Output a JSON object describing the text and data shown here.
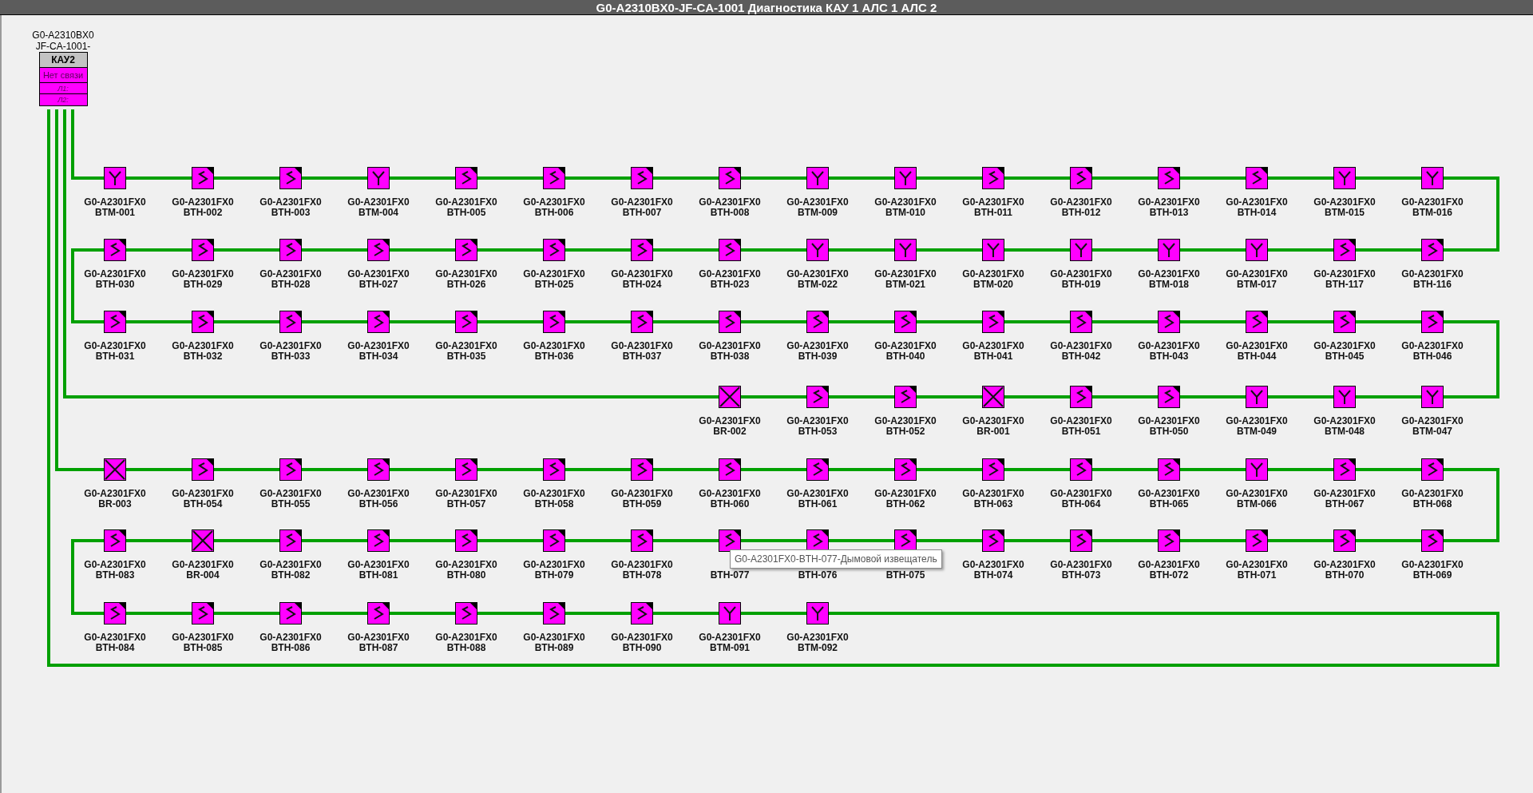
{
  "window": {
    "title": "G0-A2310BX0-JF-CA-1001 Диагностика КАУ 1 АЛС 1 АЛС 2"
  },
  "controller": {
    "caption_1": "G0-A2310BX0",
    "caption_2": "JF-CA-1001-",
    "name": "КАУ2",
    "status": "Нет связи",
    "line_1": "Л1:",
    "line_2": "Л2:"
  },
  "rows": [
    {
      "devices": [
        {
          "code": "G0-A2301FX0",
          "tag": "BTM-001",
          "kind": "heat"
        },
        {
          "code": "G0-A2301FX0",
          "tag": "BTH-002",
          "kind": "smoke"
        },
        {
          "code": "G0-A2301FX0",
          "tag": "BTH-003",
          "kind": "smoke"
        },
        {
          "code": "G0-A2301FX0",
          "tag": "BTM-004",
          "kind": "heat"
        },
        {
          "code": "G0-A2301FX0",
          "tag": "BTH-005",
          "kind": "smoke"
        },
        {
          "code": "G0-A2301FX0",
          "tag": "BTH-006",
          "kind": "smoke"
        },
        {
          "code": "G0-A2301FX0",
          "tag": "BTH-007",
          "kind": "smoke"
        },
        {
          "code": "G0-A2301FX0",
          "tag": "BTH-008",
          "kind": "smoke"
        },
        {
          "code": "G0-A2301FX0",
          "tag": "BTM-009",
          "kind": "heat"
        },
        {
          "code": "G0-A2301FX0",
          "tag": "BTM-010",
          "kind": "heat"
        },
        {
          "code": "G0-A2301FX0",
          "tag": "BTH-011",
          "kind": "smoke"
        },
        {
          "code": "G0-A2301FX0",
          "tag": "BTH-012",
          "kind": "smoke"
        },
        {
          "code": "G0-A2301FX0",
          "tag": "BTH-013",
          "kind": "smoke"
        },
        {
          "code": "G0-A2301FX0",
          "tag": "BTH-014",
          "kind": "smoke"
        },
        {
          "code": "G0-A2301FX0",
          "tag": "BTM-015",
          "kind": "heat"
        },
        {
          "code": "G0-A2301FX0",
          "tag": "BTM-016",
          "kind": "heat"
        }
      ]
    },
    {
      "devices": [
        {
          "code": "G0-A2301FX0",
          "tag": "BTH-030",
          "kind": "smoke"
        },
        {
          "code": "G0-A2301FX0",
          "tag": "BTH-029",
          "kind": "smoke"
        },
        {
          "code": "G0-A2301FX0",
          "tag": "BTH-028",
          "kind": "smoke"
        },
        {
          "code": "G0-A2301FX0",
          "tag": "BTH-027",
          "kind": "smoke"
        },
        {
          "code": "G0-A2301FX0",
          "tag": "BTH-026",
          "kind": "smoke"
        },
        {
          "code": "G0-A2301FX0",
          "tag": "BTH-025",
          "kind": "smoke"
        },
        {
          "code": "G0-A2301FX0",
          "tag": "BTH-024",
          "kind": "smoke"
        },
        {
          "code": "G0-A2301FX0",
          "tag": "BTH-023",
          "kind": "smoke"
        },
        {
          "code": "G0-A2301FX0",
          "tag": "BTM-022",
          "kind": "heat"
        },
        {
          "code": "G0-A2301FX0",
          "tag": "BTM-021",
          "kind": "heat"
        },
        {
          "code": "G0-A2301FX0",
          "tag": "BTM-020",
          "kind": "heat"
        },
        {
          "code": "G0-A2301FX0",
          "tag": "BTH-019",
          "kind": "heat"
        },
        {
          "code": "G0-A2301FX0",
          "tag": "BTM-018",
          "kind": "heat"
        },
        {
          "code": "G0-A2301FX0",
          "tag": "BTM-017",
          "kind": "heat"
        },
        {
          "code": "G0-A2301FX0",
          "tag": "BTH-117",
          "kind": "smoke"
        },
        {
          "code": "G0-A2301FX0",
          "tag": "BTH-116",
          "kind": "smoke"
        }
      ]
    },
    {
      "devices": [
        {
          "code": "G0-A2301FX0",
          "tag": "BTH-031",
          "kind": "smoke"
        },
        {
          "code": "G0-A2301FX0",
          "tag": "BTH-032",
          "kind": "smoke"
        },
        {
          "code": "G0-A2301FX0",
          "tag": "BTH-033",
          "kind": "smoke"
        },
        {
          "code": "G0-A2301FX0",
          "tag": "BTH-034",
          "kind": "smoke"
        },
        {
          "code": "G0-A2301FX0",
          "tag": "BTH-035",
          "kind": "smoke"
        },
        {
          "code": "G0-A2301FX0",
          "tag": "BTH-036",
          "kind": "smoke"
        },
        {
          "code": "G0-A2301FX0",
          "tag": "BTH-037",
          "kind": "smoke"
        },
        {
          "code": "G0-A2301FX0",
          "tag": "BTH-038",
          "kind": "smoke"
        },
        {
          "code": "G0-A2301FX0",
          "tag": "BTH-039",
          "kind": "smoke"
        },
        {
          "code": "G0-A2301FX0",
          "tag": "BTH-040",
          "kind": "smoke"
        },
        {
          "code": "G0-A2301FX0",
          "tag": "BTH-041",
          "kind": "smoke"
        },
        {
          "code": "G0-A2301FX0",
          "tag": "BTH-042",
          "kind": "smoke"
        },
        {
          "code": "G0-A2301FX0",
          "tag": "BTH-043",
          "kind": "smoke"
        },
        {
          "code": "G0-A2301FX0",
          "tag": "BTH-044",
          "kind": "smoke"
        },
        {
          "code": "G0-A2301FX0",
          "tag": "BTH-045",
          "kind": "smoke"
        },
        {
          "code": "G0-A2301FX0",
          "tag": "BTH-046",
          "kind": "smoke"
        }
      ]
    },
    {
      "devices": [
        {
          "code": "G0-A2301FX0",
          "tag": "BR-002",
          "kind": "manual"
        },
        {
          "code": "G0-A2301FX0",
          "tag": "BTH-053",
          "kind": "smoke"
        },
        {
          "code": "G0-A2301FX0",
          "tag": "BTH-052",
          "kind": "smoke"
        },
        {
          "code": "G0-A2301FX0",
          "tag": "BR-001",
          "kind": "manual"
        },
        {
          "code": "G0-A2301FX0",
          "tag": "BTH-051",
          "kind": "smoke"
        },
        {
          "code": "G0-A2301FX0",
          "tag": "BTH-050",
          "kind": "smoke"
        },
        {
          "code": "G0-A2301FX0",
          "tag": "BTM-049",
          "kind": "heat"
        },
        {
          "code": "G0-A2301FX0",
          "tag": "BTM-048",
          "kind": "heat"
        },
        {
          "code": "G0-A2301FX0",
          "tag": "BTM-047",
          "kind": "heat"
        }
      ]
    },
    {
      "devices": [
        {
          "code": "G0-A2301FX0",
          "tag": "BR-003",
          "kind": "manual"
        },
        {
          "code": "G0-A2301FX0",
          "tag": "BTH-054",
          "kind": "smoke"
        },
        {
          "code": "G0-A2301FX0",
          "tag": "BTH-055",
          "kind": "smoke"
        },
        {
          "code": "G0-A2301FX0",
          "tag": "BTH-056",
          "kind": "smoke"
        },
        {
          "code": "G0-A2301FX0",
          "tag": "BTH-057",
          "kind": "smoke"
        },
        {
          "code": "G0-A2301FX0",
          "tag": "BTH-058",
          "kind": "smoke"
        },
        {
          "code": "G0-A2301FX0",
          "tag": "BTH-059",
          "kind": "smoke"
        },
        {
          "code": "G0-A2301FX0",
          "tag": "BTH-060",
          "kind": "smoke"
        },
        {
          "code": "G0-A2301FX0",
          "tag": "BTH-061",
          "kind": "smoke"
        },
        {
          "code": "G0-A2301FX0",
          "tag": "BTH-062",
          "kind": "smoke"
        },
        {
          "code": "G0-A2301FX0",
          "tag": "BTH-063",
          "kind": "smoke"
        },
        {
          "code": "G0-A2301FX0",
          "tag": "BTH-064",
          "kind": "smoke"
        },
        {
          "code": "G0-A2301FX0",
          "tag": "BTH-065",
          "kind": "smoke"
        },
        {
          "code": "G0-A2301FX0",
          "tag": "BTM-066",
          "kind": "heat"
        },
        {
          "code": "G0-A2301FX0",
          "tag": "BTH-067",
          "kind": "smoke"
        },
        {
          "code": "G0-A2301FX0",
          "tag": "BTH-068",
          "kind": "smoke"
        }
      ]
    },
    {
      "devices": [
        {
          "code": "G0-A2301FX0",
          "tag": "BTH-083",
          "kind": "smoke"
        },
        {
          "code": "G0-A2301FX0",
          "tag": "BR-004",
          "kind": "manual"
        },
        {
          "code": "G0-A2301FX0",
          "tag": "BTH-082",
          "kind": "smoke"
        },
        {
          "code": "G0-A2301FX0",
          "tag": "BTH-081",
          "kind": "smoke"
        },
        {
          "code": "G0-A2301FX0",
          "tag": "BTH-080",
          "kind": "smoke"
        },
        {
          "code": "G0-A2301FX0",
          "tag": "BTH-079",
          "kind": "smoke"
        },
        {
          "code": "G0-A2301FX0",
          "tag": "BTH-078",
          "kind": "smoke"
        },
        {
          "tag": "BTH-077",
          "kind": "smoke"
        },
        {
          "tag": "BTH-076",
          "kind": "smoke"
        },
        {
          "tag": "BTH-075",
          "kind": "smoke"
        },
        {
          "code": "G0-A2301FX0",
          "tag": "BTH-074",
          "kind": "smoke"
        },
        {
          "code": "G0-A2301FX0",
          "tag": "BTH-073",
          "kind": "smoke"
        },
        {
          "code": "G0-A2301FX0",
          "tag": "BTH-072",
          "kind": "smoke"
        },
        {
          "code": "G0-A2301FX0",
          "tag": "BTH-071",
          "kind": "smoke"
        },
        {
          "code": "G0-A2301FX0",
          "tag": "BTH-070",
          "kind": "smoke"
        },
        {
          "code": "G0-A2301FX0",
          "tag": "BTH-069",
          "kind": "smoke"
        }
      ]
    },
    {
      "devices": [
        {
          "code": "G0-A2301FX0",
          "tag": "BTH-084",
          "kind": "smoke"
        },
        {
          "code": "G0-A2301FX0",
          "tag": "BTH-085",
          "kind": "smoke"
        },
        {
          "code": "G0-A2301FX0",
          "tag": "BTH-086",
          "kind": "smoke"
        },
        {
          "code": "G0-A2301FX0",
          "tag": "BTH-087",
          "kind": "smoke"
        },
        {
          "code": "G0-A2301FX0",
          "tag": "BTH-088",
          "kind": "smoke"
        },
        {
          "code": "G0-A2301FX0",
          "tag": "BTH-089",
          "kind": "smoke"
        },
        {
          "code": "G0-A2301FX0",
          "tag": "BTH-090",
          "kind": "smoke"
        },
        {
          "code": "G0-A2301FX0",
          "tag": "BTM-091",
          "kind": "heat"
        },
        {
          "code": "G0-A2301FX0",
          "tag": "BTM-092",
          "kind": "heat"
        }
      ]
    }
  ],
  "tooltip": {
    "text": "G0-A2301FX0-BTH-077-Дымовой извещатель"
  }
}
